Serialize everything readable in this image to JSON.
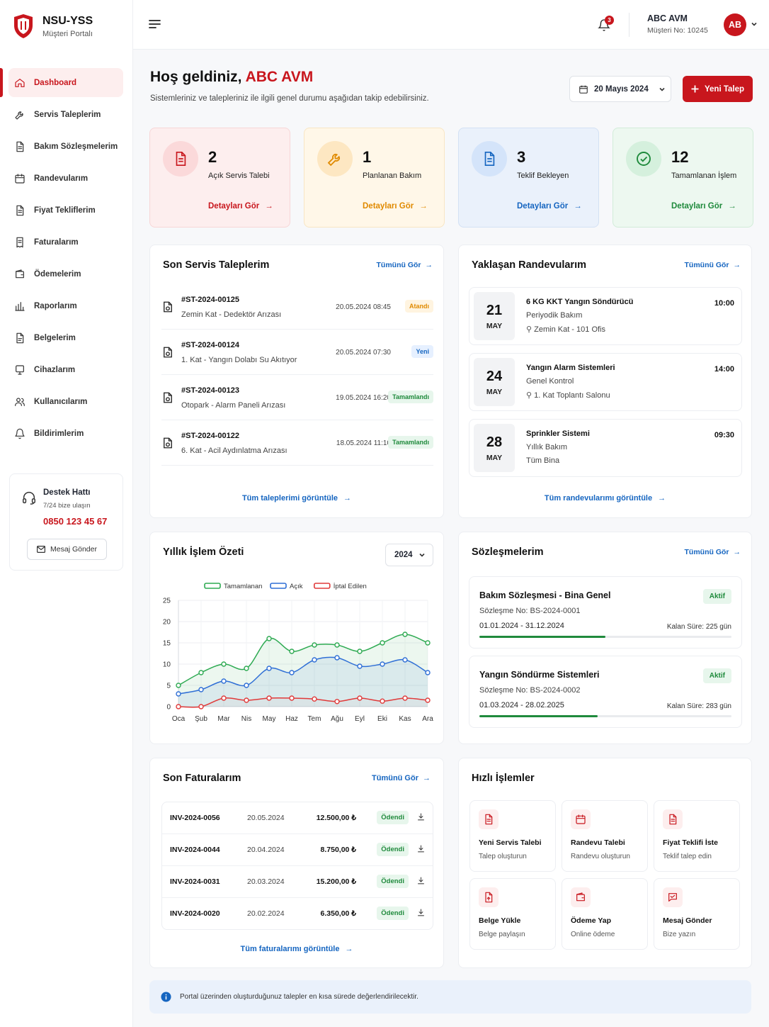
{
  "brand": {
    "title": "NSU-YSS",
    "subtitle": "Müşteri Portalı"
  },
  "nav": [
    {
      "label": "Dashboard",
      "icon": "home-icon",
      "active": true
    },
    {
      "label": "Servis Taleplerim",
      "icon": "wrench-icon"
    },
    {
      "label": "Bakım Sözleşmelerim",
      "icon": "document-icon"
    },
    {
      "label": "Randevularım",
      "icon": "calendar-icon"
    },
    {
      "label": "Fiyat Tekliflerim",
      "icon": "document-icon"
    },
    {
      "label": "Faturalarım",
      "icon": "invoice-icon"
    },
    {
      "label": "Ödemelerim",
      "icon": "wallet-icon"
    },
    {
      "label": "Raporlarım",
      "icon": "bar-chart-icon"
    },
    {
      "label": "Belgelerim",
      "icon": "file-icon"
    },
    {
      "label": "Cihazlarım",
      "icon": "device-icon"
    },
    {
      "label": "Kullanıcılarım",
      "icon": "users-icon"
    },
    {
      "label": "Bildirimlerim",
      "icon": "bell-icon"
    }
  ],
  "support": {
    "title": "Destek Hattı",
    "subtitle": "7/24 bize ulaşın",
    "phone": "0850 123 45 67",
    "button": "Mesaj Gönder"
  },
  "header": {
    "notification_count": "3",
    "user_name": "ABC AVM",
    "customer_no": "Müşteri No: 10245",
    "avatar": "AB"
  },
  "welcome": {
    "greeting": "Hoş geldiniz,",
    "name": "ABC AVM",
    "subtitle": "Sistemleriniz ve talepleriniz ile ilgili genel durumu aşağıdan takip edebilirsiniz.",
    "date": "20 Mayıs 2024",
    "new_button": "Yeni Talep"
  },
  "stats": [
    {
      "value": "2",
      "label": "Açık Servis Talebi",
      "link": "Detayları Gör",
      "color": "#c8161d"
    },
    {
      "value": "1",
      "label": "Planlanan Bakım",
      "link": "Detayları Gör",
      "color": "#e08a00"
    },
    {
      "value": "3",
      "label": "Teklif Bekleyen",
      "link": "Detayları Gör",
      "color": "#1565c0"
    },
    {
      "value": "12",
      "label": "Tamamlanan İşlem",
      "link": "Detayları Gör",
      "color": "#1f8a3c"
    }
  ],
  "service": {
    "title": "Son Servis Taleplerim",
    "all": "Tümünü Gör",
    "footer": "Tüm taleplerimi görüntüle",
    "rows": [
      {
        "id": "#ST-2024-00125",
        "desc": "Zemin Kat - Dedektör Arızası",
        "date": "20.05.2024 08:45",
        "status": "Atandı",
        "kind": "o"
      },
      {
        "id": "#ST-2024-00124",
        "desc": "1. Kat - Yangın Dolabı Su Akıtıyor",
        "date": "20.05.2024 07:30",
        "status": "Yeni",
        "kind": "b"
      },
      {
        "id": "#ST-2024-00123",
        "desc": "Otopark - Alarm Paneli Arızası",
        "date": "19.05.2024 16:20",
        "status": "Tamamlandı",
        "kind": "g"
      },
      {
        "id": "#ST-2024-00122",
        "desc": "6. Kat - Acil Aydınlatma Arızası",
        "date": "18.05.2024 11:10",
        "status": "Tamamlandı",
        "kind": "g"
      }
    ]
  },
  "appointments": {
    "title": "Yaklaşan Randevularım",
    "all": "Tümünü Gör",
    "footer": "Tüm randevularımı görüntüle",
    "rows": [
      {
        "day": "21",
        "month": "MAY",
        "title": "6 KG KKT Yangın Söndürücü",
        "type": "Periyodik Bakım",
        "place": "Zemin Kat - 101 Ofis",
        "time": "10:00",
        "pin": true
      },
      {
        "day": "24",
        "month": "MAY",
        "title": "Yangın Alarm Sistemleri",
        "type": "Genel Kontrol",
        "place": "1. Kat Toplantı Salonu",
        "time": "14:00",
        "pin": true
      },
      {
        "day": "28",
        "month": "MAY",
        "title": "Sprinkler Sistemi",
        "type": "Yıllık Bakım",
        "place": "Tüm Bina",
        "time": "09:30",
        "pin": false
      }
    ]
  },
  "annual": {
    "title": "Yıllık İşlem Özeti",
    "year": "2024"
  },
  "chart_data": {
    "type": "line",
    "categories": [
      "Oca",
      "Şub",
      "Mar",
      "Nis",
      "May",
      "Haz",
      "Tem",
      "Ağu",
      "Eyl",
      "Eki",
      "Kas",
      "Ara"
    ],
    "series": [
      {
        "name": "Tamamlanan",
        "color": "#2eaa52",
        "values": [
          5,
          8,
          10,
          9,
          16,
          13,
          14.5,
          14.5,
          13,
          15,
          17,
          15
        ]
      },
      {
        "name": "Açık",
        "color": "#2f6fd6",
        "values": [
          3,
          4,
          6,
          5,
          9,
          8,
          11,
          11.5,
          9.5,
          10,
          11,
          8
        ]
      },
      {
        "name": "İptal Edilen",
        "color": "#e03a3a",
        "values": [
          0,
          0,
          2,
          1.5,
          2,
          2,
          1.8,
          1.2,
          2,
          1.3,
          2,
          1.5
        ]
      }
    ],
    "ylim": [
      0,
      25
    ],
    "yticks": [
      0,
      5,
      10,
      15,
      20,
      25
    ],
    "legend": "top",
    "grid": true
  },
  "contracts": {
    "title": "Sözleşmelerim",
    "all": "Tümünü Gör",
    "rows": [
      {
        "name": "Bakım Sözleşmesi - Bina Genel",
        "no": "Sözleşme No: BS-2024-0001",
        "range": "01.01.2024 - 31.12.2024",
        "status": "Aktif",
        "remaining": "Kalan Süre: 225 gün",
        "progress": 0.5
      },
      {
        "name": "Yangın Söndürme Sistemleri",
        "no": "Sözleşme No: BS-2024-0002",
        "range": "01.03.2024 - 28.02.2025",
        "status": "Aktif",
        "remaining": "Kalan Süre: 283 gün",
        "progress": 0.47
      }
    ]
  },
  "invoices": {
    "title": "Son Faturalarım",
    "all": "Tümünü Gör",
    "footer": "Tüm faturalarımı görüntüle",
    "rows": [
      {
        "id": "INV-2024-0056",
        "date": "20.05.2024",
        "amount": "12.500,00 ₺",
        "status": "Ödendi"
      },
      {
        "id": "INV-2024-0044",
        "date": "20.04.2024",
        "amount": "8.750,00 ₺",
        "status": "Ödendi"
      },
      {
        "id": "INV-2024-0031",
        "date": "20.03.2024",
        "amount": "15.200,00 ₺",
        "status": "Ödendi"
      },
      {
        "id": "INV-2024-0020",
        "date": "20.02.2024",
        "amount": "6.350,00 ₺",
        "status": "Ödendi"
      }
    ]
  },
  "quick": {
    "title": "Hızlı İşlemler",
    "items": [
      {
        "title": "Yeni Servis Talebi",
        "sub": "Talep oluşturun",
        "icon": "document-icon"
      },
      {
        "title": "Randevu Talebi",
        "sub": "Randevu oluşturun",
        "icon": "calendar-icon"
      },
      {
        "title": "Fiyat Teklifi İste",
        "sub": "Teklif talep edin",
        "icon": "document-icon"
      },
      {
        "title": "Belge Yükle",
        "sub": "Belge paylaşın",
        "icon": "upload-file-icon"
      },
      {
        "title": "Ödeme Yap",
        "sub": "Online ödeme",
        "icon": "wallet-icon"
      },
      {
        "title": "Mesaj Gönder",
        "sub": "Bize yazın",
        "icon": "message-icon"
      }
    ]
  },
  "info": "Portal üzerinden oluşturduğunuz talepler en kısa sürede değerlendirilecektir."
}
